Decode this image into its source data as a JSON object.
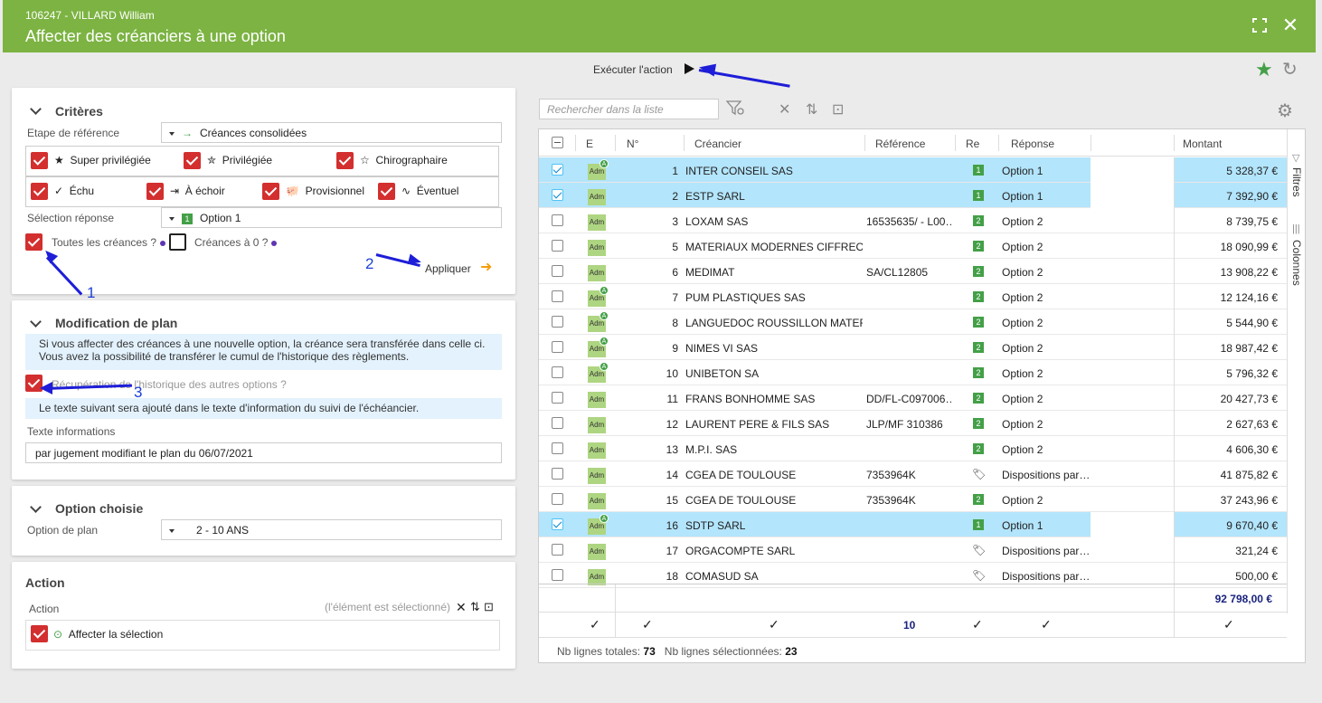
{
  "header": {
    "subtitle": "106247 - VILLARD William",
    "title": "Affecter des créanciers à une option"
  },
  "toolbar": {
    "execute_label": "Exécuter l'action"
  },
  "criteres": {
    "title": "Critères",
    "etape_label": "Etape de référence",
    "etape_value": "Créances consolidées",
    "priv_row1": [
      "Super privilégiée",
      "Privilégiée",
      "Chirographaire"
    ],
    "priv_row2": [
      "Échu",
      "À échoir",
      "Provisionnel",
      "Éventuel"
    ],
    "selection_label": "Sélection réponse",
    "selection_badge": "1",
    "selection_value": "Option 1",
    "toutes_label": "Toutes les créances ?",
    "zero_label": "Créances à 0 ?",
    "apply_label": "Appliquer"
  },
  "modification": {
    "title": "Modification de plan",
    "info1_line1": "Si vous affecter des créances à une nouvelle option, la créance sera transférée dans celle ci.",
    "info1_line2": "Vous avez la possibilité de transférer le cumul de l'historique des règlements.",
    "recup_label": "Récupération de l'historique des autres options ?",
    "info2": "Le texte suivant sera ajouté dans le texte d'information du suivi de l'échéancier.",
    "texte_label": "Texte informations",
    "texte_value": "par jugement modifiant le plan du 06/07/2021"
  },
  "option": {
    "title": "Option choisie",
    "label": "Option de plan",
    "value": "2  - 10 ANS"
  },
  "action": {
    "title": "Action",
    "label": "Action",
    "selected_note": "(l'élément est sélectionné)",
    "item": "Affecter la sélection"
  },
  "grid": {
    "search_placeholder": "Rechercher dans la liste",
    "headers": {
      "e": "E",
      "n": "N°",
      "creancier": "Créancier",
      "reference": "Référence",
      "re": "Re",
      "reponse": "Réponse",
      "montant": "Montant"
    },
    "rows": [
      {
        "n": "1",
        "creancier": "INTER CONSEIL SAS",
        "ref": "",
        "badge": "1",
        "reponse": "Option 1",
        "montant": "5 328,37 €",
        "sel": true,
        "a": true
      },
      {
        "n": "2",
        "creancier": "ESTP SARL",
        "ref": "",
        "badge": "1",
        "reponse": "Option 1",
        "montant": "7 392,90 €",
        "sel": true,
        "a": false
      },
      {
        "n": "3",
        "creancier": "LOXAM SAS",
        "ref": "16535635/ - L00…",
        "badge": "2",
        "reponse": "Option 2",
        "montant": "8 739,75 €",
        "sel": false,
        "a": false
      },
      {
        "n": "5",
        "creancier": "MATERIAUX MODERNES CIFFREO …",
        "ref": "",
        "badge": "2",
        "reponse": "Option 2",
        "montant": "18 090,99 €",
        "sel": false,
        "a": false
      },
      {
        "n": "6",
        "creancier": "MEDIMAT",
        "ref": "SA/CL12805",
        "badge": "2",
        "reponse": "Option 2",
        "montant": "13 908,22 €",
        "sel": false,
        "a": false
      },
      {
        "n": "7",
        "creancier": "PUM PLASTIQUES SAS",
        "ref": "",
        "badge": "2",
        "reponse": "Option 2",
        "montant": "12 124,16 €",
        "sel": false,
        "a": true
      },
      {
        "n": "8",
        "creancier": "LANGUEDOC ROUSSILLON MATERI…",
        "ref": "",
        "badge": "2",
        "reponse": "Option 2",
        "montant": "5 544,90 €",
        "sel": false,
        "a": true
      },
      {
        "n": "9",
        "creancier": "NIMES VI SAS",
        "ref": "",
        "badge": "2",
        "reponse": "Option 2",
        "montant": "18 987,42 €",
        "sel": false,
        "a": true
      },
      {
        "n": "10",
        "creancier": "UNIBETON SA",
        "ref": "",
        "badge": "2",
        "reponse": "Option 2",
        "montant": "5 796,32 €",
        "sel": false,
        "a": true
      },
      {
        "n": "11",
        "creancier": "FRANS BONHOMME SAS",
        "ref": "DD/FL-C097006…",
        "badge": "2",
        "reponse": "Option 2",
        "montant": "20 427,73 €",
        "sel": false,
        "a": false
      },
      {
        "n": "12",
        "creancier": "LAURENT PERE & FILS SAS",
        "ref": "JLP/MF 310386",
        "badge": "2",
        "reponse": "Option 2",
        "montant": "2 627,63 €",
        "sel": false,
        "a": false
      },
      {
        "n": "13",
        "creancier": "M.P.I. SAS",
        "ref": "",
        "badge": "2",
        "reponse": "Option 2",
        "montant": "4 606,30 €",
        "sel": false,
        "a": false
      },
      {
        "n": "14",
        "creancier": "CGEA DE TOULOUSE",
        "ref": "7353964K",
        "badge": "tag",
        "reponse": "Dispositions par…",
        "montant": "41 875,82 €",
        "sel": false,
        "a": false
      },
      {
        "n": "15",
        "creancier": "CGEA DE TOULOUSE",
        "ref": "7353964K",
        "badge": "2",
        "reponse": "Option 2",
        "montant": "37 243,96 €",
        "sel": false,
        "a": false
      },
      {
        "n": "16",
        "creancier": "SDTP SARL",
        "ref": "",
        "badge": "1",
        "reponse": "Option 1",
        "montant": "9 670,40 €",
        "sel": true,
        "a": true
      },
      {
        "n": "17",
        "creancier": "ORGACOMPTE SARL",
        "ref": "",
        "badge": "tag",
        "reponse": "Dispositions par…",
        "montant": "321,24 €",
        "sel": false,
        "a": false
      },
      {
        "n": "18",
        "creancier": "COMASUD SA",
        "ref": "",
        "badge": "tag",
        "reponse": "Dispositions par…",
        "montant": "500,00 €",
        "sel": false,
        "a": false
      }
    ],
    "adm_label": "Adm",
    "a_label": "A",
    "total": "92 798,00 €",
    "ref_count": "10",
    "sidebar_filtres": "Filtres",
    "sidebar_colonnes": "Colonnes",
    "footer_total_label": "Nb lignes totales:",
    "footer_total": "73",
    "footer_sel_label": "Nb lignes sélectionnées:",
    "footer_sel": "23"
  },
  "annotations": [
    "1",
    "2",
    "3"
  ]
}
